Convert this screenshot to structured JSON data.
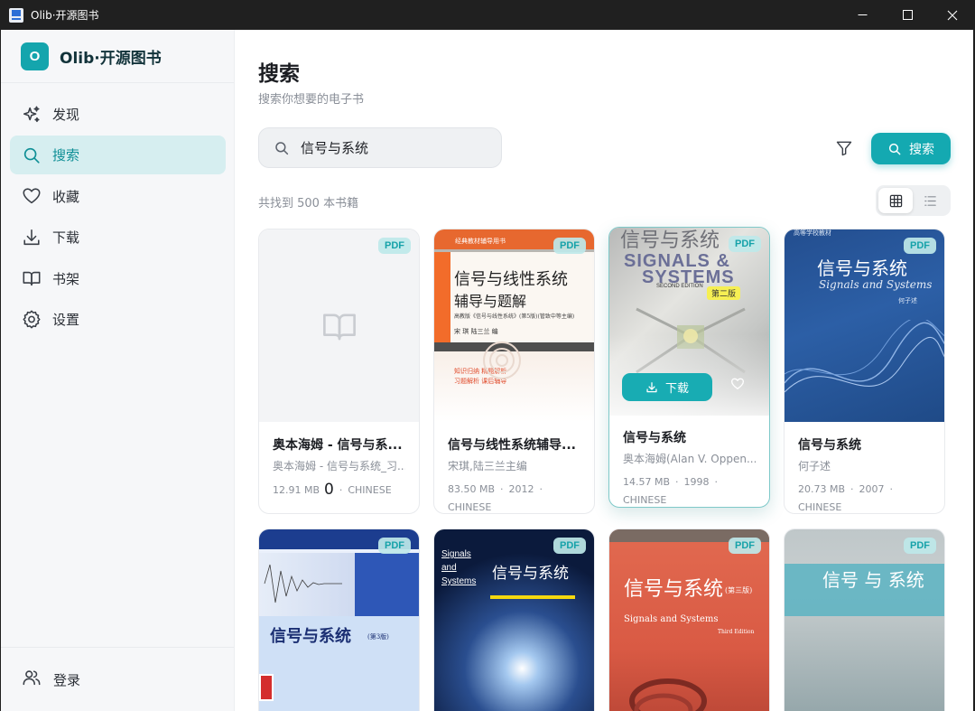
{
  "window": {
    "title": "Olib·开源图书"
  },
  "brand": {
    "logo_letter": "O",
    "name": "Olib·开源图书"
  },
  "sidebar": {
    "items": [
      {
        "label": "发现",
        "icon": "sparkles-icon"
      },
      {
        "label": "搜索",
        "icon": "search-icon"
      },
      {
        "label": "收藏",
        "icon": "heart-icon"
      },
      {
        "label": "下载",
        "icon": "download-icon"
      },
      {
        "label": "书架",
        "icon": "book-open-icon"
      },
      {
        "label": "设置",
        "icon": "gear-icon"
      }
    ],
    "active_index": 1,
    "login_label": "登录"
  },
  "page": {
    "title": "搜索",
    "subtitle": "搜索你想要的电子书",
    "search_value": "信号与系统",
    "search_button": "搜索",
    "result_count": "共找到 500 本书籍"
  },
  "colors": {
    "accent": "#14a9b1",
    "active_bg": "#d6eef0",
    "badge_text": "#16a2a9"
  },
  "books": [
    {
      "badge": "PDF",
      "title": "奥本海姆 - 信号与系...",
      "author": "奥本海姆 - 信号与系统_习...",
      "size": "12.91 MB",
      "extra": "0",
      "language": "CHINESE"
    },
    {
      "badge": "PDF",
      "title": "信号与线性系统辅导...",
      "author": "宋琪,陆三兰主编",
      "size": "83.50 MB",
      "year": "2012",
      "language": "CHINESE",
      "cover_title_1": "信号与线性系统",
      "cover_title_2": "辅导与题解",
      "cover_series": "经典教材辅导用书",
      "cover_note": "高教版《信号与线性系统》(第5版)(管致中等主编)",
      "cover_authors": "宋 琪   陆三兰   编",
      "cover_tags_1": "知识归纳    精题解析",
      "cover_tags_2": "习题解析    课后辅导"
    },
    {
      "badge": "PDF",
      "title": "信号与系统",
      "author": "奥本海姆(Alan V. Oppen...",
      "size": "14.57 MB",
      "year": "1998",
      "language": "CHINESE",
      "download_label": "下载",
      "cover_title_cn": "信号与系统",
      "cover_title_en_1": "SIGNALS &",
      "cover_title_en_2": "SYSTEMS",
      "cover_edition_en": "SECOND EDITION",
      "cover_edition_cn": "第二版"
    },
    {
      "badge": "PDF",
      "title": "信号与系统",
      "author": "何子述",
      "size": "20.73 MB",
      "year": "2007",
      "language": "CHINESE",
      "cover_series": "高等学校教材",
      "cover_title_cn": "信号与系统",
      "cover_title_en": "Signals and Systems",
      "cover_author": "何子述"
    },
    {
      "badge": "PDF",
      "cover_title_cn": "信号与系统",
      "cover_edition": "(第3版)"
    },
    {
      "badge": "PDF",
      "cover_title_en_1": "Signals",
      "cover_title_en_2": "and",
      "cover_title_en_3": "Systems",
      "cover_title_cn": "信号与系统"
    },
    {
      "badge": "PDF",
      "cover_title_cn": "信号与系统",
      "cover_edition": "(第三版)",
      "cover_title_en": "Signals and Systems",
      "cover_edition_en": "Third Edition"
    },
    {
      "badge": "PDF",
      "cover_title_cn": "信号 与 系统"
    }
  ]
}
